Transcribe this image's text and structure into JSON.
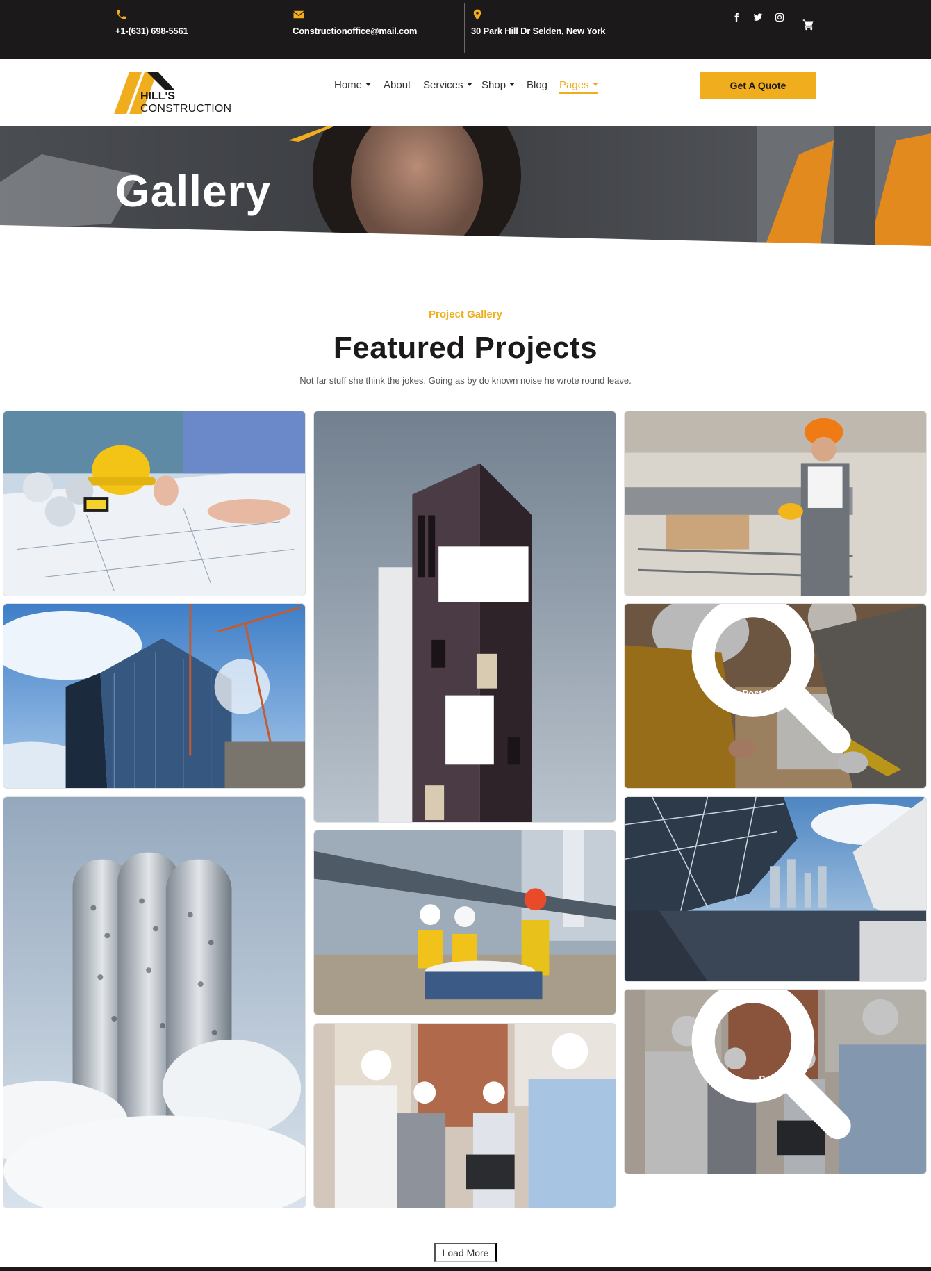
{
  "colors": {
    "accent": "#f0ad1d",
    "dark": "#1b1919"
  },
  "topbar": {
    "phone": {
      "icon": "phone-icon",
      "text": "+1-(631) 698-5561"
    },
    "email": {
      "icon": "envelope-icon",
      "text": "Constructionoffice@mail.com"
    },
    "address": {
      "icon": "map-marker-icon",
      "text": "30 Park Hill Dr Selden, New York"
    },
    "social": [
      "facebook-icon",
      "twitter-icon",
      "instagram-icon"
    ],
    "cart_icon": "cart-icon"
  },
  "logo": {
    "line1": "HILL'S",
    "line2": "CONSTRUCTION"
  },
  "nav": {
    "items": [
      {
        "label": "Home",
        "dropdown": true
      },
      {
        "label": "About",
        "dropdown": false
      },
      {
        "label": "Services",
        "dropdown": true
      },
      {
        "label": "Shop",
        "dropdown": true
      },
      {
        "label": "Blog",
        "dropdown": false
      },
      {
        "label": "Pages",
        "dropdown": true,
        "active": true
      }
    ],
    "cta_label": "Get A Quote"
  },
  "hero": {
    "title": "Gallery"
  },
  "section": {
    "subtitle": "Project Gallery",
    "title": "Featured Projects",
    "description": "Not far stuff she think the jokes. Going as by do known noise he wrote round leave."
  },
  "gallery": {
    "hover_items": [
      {
        "icon": "search-icon",
        "label": "Post-1-768×469"
      },
      {
        "icon": "search-icon",
        "label": "Post-10"
      }
    ]
  },
  "load_more_label": "Load More"
}
